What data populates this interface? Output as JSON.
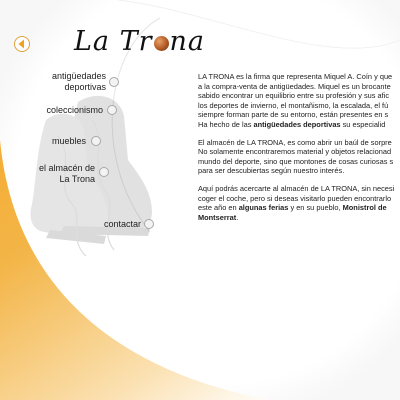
{
  "logo": {
    "text_before": "La Tr",
    "text_after": "na"
  },
  "nav": {
    "back_icon": "chevron-left-icon",
    "items": [
      {
        "lines": [
          "antigüedades",
          "deportivas"
        ]
      },
      {
        "lines": [
          "coleccionismo"
        ]
      },
      {
        "lines": [
          "muebles"
        ]
      },
      {
        "lines": [
          "el almacén de",
          "La Trona"
        ]
      },
      {
        "lines": [
          "contactar"
        ]
      }
    ]
  },
  "content": {
    "paragraphs": [
      {
        "lines": [
          [
            {
              "text": "LA TRONA es la firma que representa Miquel A. Coín y que"
            }
          ],
          [
            {
              "text": "a la compra-venta de antigüedades. Miquel es un brocante"
            }
          ],
          [
            {
              "text": "sabido encontrar un equilibrio entre su profesión y sus afic"
            }
          ],
          [
            {
              "text": "los deportes de invierno, el montañismo, la escalada, el fú"
            }
          ],
          [
            {
              "text": "siempre forman parte de su entorno, están presentes en s"
            }
          ],
          [
            {
              "text": "Ha hecho de las "
            },
            {
              "text": "antigüedades deportivas",
              "bold": true
            },
            {
              "text": " su especialid"
            }
          ]
        ]
      },
      {
        "lines": [
          [
            {
              "text": "El almacén de LA TRONA, es como abrir un baúl de sorpre"
            }
          ],
          [
            {
              "text": "No solamente encontraremos material y objetos relacionad"
            }
          ],
          [
            {
              "text": "mundo del deporte, sino que montones de cosas curiosas s"
            }
          ],
          [
            {
              "text": "para ser descubiertas según nuestro interés."
            }
          ]
        ]
      },
      {
        "lines": [
          [
            {
              "text": "Aquí podrás acercarte al almacén de LA TRONA, sin necesi"
            }
          ],
          [
            {
              "text": "coger el coche, pero si deseas visitarlo pueden encontrarlo"
            }
          ],
          [
            {
              "text": "este año en "
            },
            {
              "text": "algunas ferias",
              "bold": true
            },
            {
              "text": " y en su pueblo, "
            },
            {
              "text": "Monistrol de",
              "bold": true
            }
          ],
          [
            {
              "text": "Montserrat",
              "bold": true
            },
            {
              "text": "."
            }
          ]
        ]
      }
    ]
  },
  "colors": {
    "accent": "#f0a21c",
    "accent_light": "#fbe2b0",
    "text": "#222222"
  }
}
